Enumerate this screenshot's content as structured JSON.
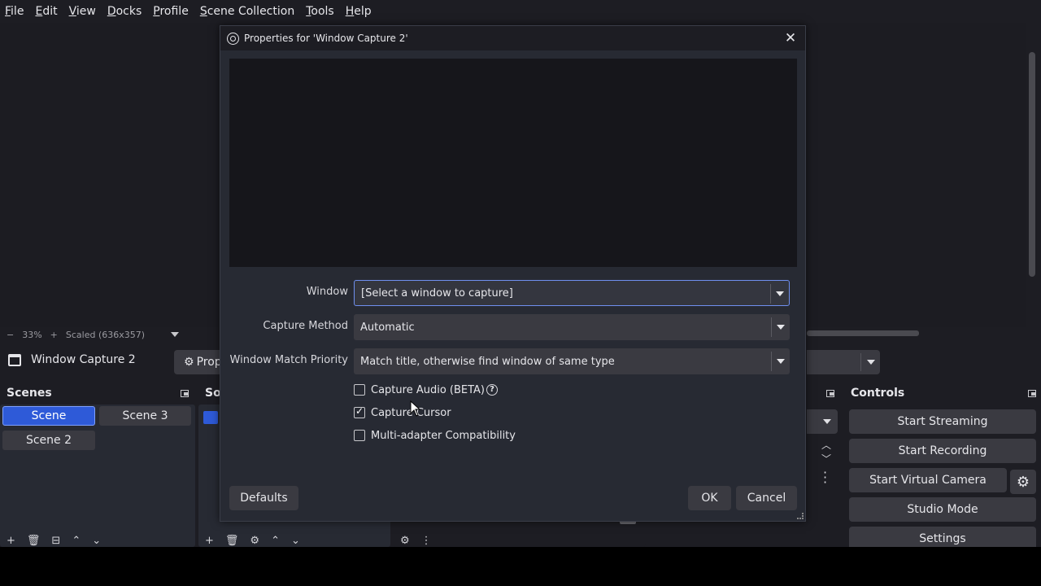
{
  "menu": [
    "File",
    "Edit",
    "View",
    "Docks",
    "Profile",
    "Scene Collection",
    "Tools",
    "Help"
  ],
  "zoom": {
    "minus": "−",
    "percent": "33%",
    "plus": "+",
    "scaled": "Scaled (636x357)"
  },
  "source_bar": {
    "name": "Window Capture 2",
    "properties_label": "Prop"
  },
  "scenes": {
    "title": "Scenes",
    "items": [
      {
        "label": "Scene",
        "active": true
      },
      {
        "label": "Scene 3",
        "active": false
      },
      {
        "label": "Scene 2",
        "active": false
      }
    ]
  },
  "sources": {
    "title": "Sou"
  },
  "controls": {
    "title": "Controls",
    "buttons": [
      "Start Streaming",
      "Start Recording",
      "Start Virtual Camera",
      "Studio Mode",
      "Settings"
    ]
  },
  "dialog": {
    "title": "Properties for 'Window Capture 2'",
    "close": "✕",
    "window_label": "Window",
    "window_value": "[Select a window to capture]",
    "capture_method_label": "Capture Method",
    "capture_method_value": "Automatic",
    "match_priority_label": "Window Match Priority",
    "match_priority_value": "Match title, otherwise find window of same type",
    "checkboxes": [
      {
        "label": "Capture Audio (BETA)",
        "checked": false
      },
      {
        "label": "Capture Cursor",
        "checked": true
      },
      {
        "label": "Multi-adapter Compatibility",
        "checked": false
      }
    ],
    "help_glyph": "?",
    "defaults": "Defaults",
    "ok": "OK",
    "cancel": "Cancel"
  },
  "colors": {
    "accent": "#2e5ad8",
    "dialog_bg": "#272a33",
    "app_bg": "#1d1d23"
  }
}
